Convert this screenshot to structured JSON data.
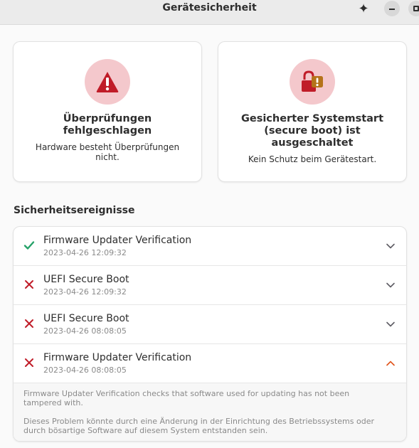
{
  "window": {
    "title": "Gerätesicherheit"
  },
  "headerbar": {
    "icons": [
      "sparkle-icon",
      "minimize-icon",
      "maximize-icon"
    ]
  },
  "cards": [
    {
      "icon": "warning-triangle-icon",
      "title": "Überprüfungen fehlgeschlagen",
      "subtitle": "Hardware besteht Überprüfungen nicht."
    },
    {
      "icon": "unlocked-padlock-warning-icon",
      "title": "Gesicherter Systemstart (secure boot) ist ausgeschaltet",
      "subtitle": "Kein Schutz beim Gerätestart."
    }
  ],
  "events_section": {
    "title": "Sicherheitsereignisse",
    "items": [
      {
        "status": "success",
        "title": "Firmware Updater Verification",
        "time": "2023-04-26 12:09:32",
        "expanded": false
      },
      {
        "status": "failure",
        "title": "UEFI Secure Boot",
        "time": "2023-04-26 12:09:32",
        "expanded": false
      },
      {
        "status": "failure",
        "title": "UEFI Secure Boot",
        "time": "2023-04-26 08:08:05",
        "expanded": false
      },
      {
        "status": "failure",
        "title": "Firmware Updater Verification",
        "time": "2023-04-26 08:08:05",
        "expanded": true
      }
    ],
    "expanded_detail": {
      "description": "Firmware Updater Verification checks that software used for updating has not been tampered with.",
      "explanation": "Dieses Problem könnte durch eine Änderung in der Einrichtung des Betriebssystems oder durch bösartige Software auf diesem System entstanden sein."
    }
  },
  "colors": {
    "danger": "#c01c28",
    "success": "#26a269",
    "icon_circle": "#f4c8cc",
    "expanded_chevron": "#e0531a",
    "lock_badge": "#b5731a"
  }
}
